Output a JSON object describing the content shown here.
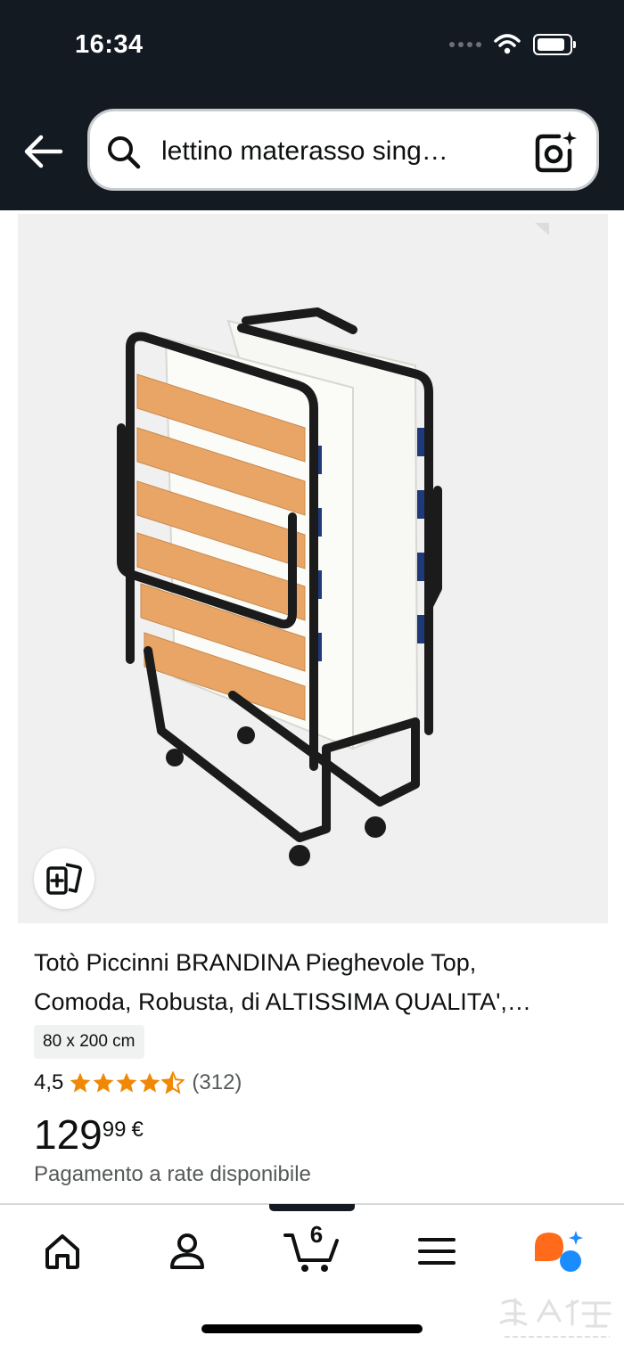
{
  "status_bar": {
    "time": "16:34",
    "icons": [
      "signal-dots-icon",
      "wifi-icon",
      "battery-icon"
    ]
  },
  "header": {
    "back_icon": "arrow-left-icon",
    "search": {
      "query": "lettino materasso sing…",
      "search_icon": "search-icon",
      "camera_icon": "camera-sparkle-icon"
    }
  },
  "product": {
    "image_alt_icon": "folding-bed-image",
    "compare_icon": "compare-cards-icon",
    "title_line1": "Totò Piccinni BRANDINA Pieghevole Top,",
    "title_line2": "Comoda, Robusta, di ALTISSIMA QUALITA',…",
    "size_option": "80 x 200 cm",
    "rating": "4,5",
    "rating_stars": 4.5,
    "review_count": "(312)",
    "price_whole": "129",
    "price_fraction": "99",
    "price_currency": "€",
    "installments": "Pagamento a rate disponibile"
  },
  "bottom_nav": {
    "items": [
      "home-icon",
      "account-icon",
      "cart-icon",
      "menu-icon",
      "rufus-ai-icon"
    ],
    "cart_count": "6"
  },
  "watermark": "HUARENJIEI",
  "colors": {
    "header_bg": "#131a22",
    "star": "#f08804",
    "rufus_orange": "#ff6b1a",
    "rufus_blue": "#1a8cff"
  }
}
